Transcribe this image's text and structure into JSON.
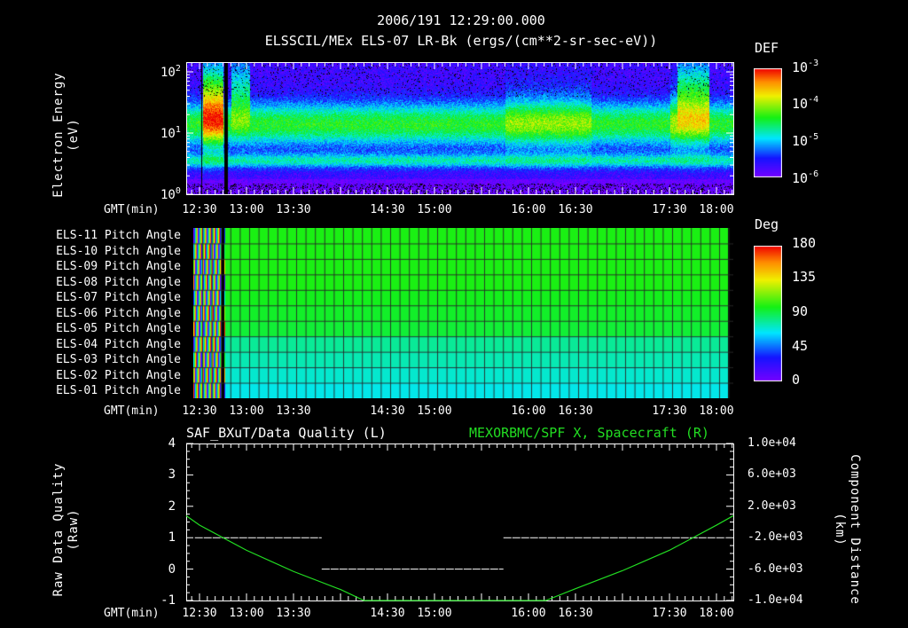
{
  "header": {
    "title_line1": "2006/191 12:29:00.000",
    "title_line2": "ELSSCIL/MEx ELS-07 LR-Bk  (ergs/(cm**2-sr-sec-eV))"
  },
  "time_axis": {
    "label": "GMT(min)",
    "ticks": [
      {
        "label": "12:30",
        "min": 0
      },
      {
        "label": "13:00",
        "min": 30
      },
      {
        "label": "13:30",
        "min": 60
      },
      {
        "label": "14:30",
        "min": 120
      },
      {
        "label": "15:00",
        "min": 150
      },
      {
        "label": "16:00",
        "min": 210
      },
      {
        "label": "16:30",
        "min": 240
      },
      {
        "label": "17:30",
        "min": 300
      },
      {
        "label": "18:00",
        "min": 330
      }
    ],
    "range_min": [
      -8.5,
      340.7
    ]
  },
  "chart_data": [
    {
      "type": "heatmap",
      "title": "ELSSCIL/MEx ELS-07 LR-Bk  (ergs/(cm**2-sr-sec-eV))",
      "ylabel_line1": "Electron Energy",
      "ylabel_line2": "(eV)",
      "yscale": "log",
      "ylim": [
        1,
        145
      ],
      "yticks": [
        {
          "base": "10",
          "exp": "0",
          "value": 1
        },
        {
          "base": "10",
          "exp": "1",
          "value": 10
        },
        {
          "base": "10",
          "exp": "2",
          "value": 100
        }
      ],
      "colorbar": {
        "label": "DEF",
        "scale": "log",
        "range": [
          1e-06,
          0.001
        ],
        "ticks": [
          {
            "base": "10",
            "exp": "-3"
          },
          {
            "base": "10",
            "exp": "-4"
          },
          {
            "base": "10",
            "exp": "-5"
          },
          {
            "base": "10",
            "exp": "-6"
          }
        ]
      },
      "features": "main flux band ~5-30 eV at ~1e-5 to 1e-4; enhancements near 12:35-12:45, 16:00-16:45, 17:30-18:00"
    },
    {
      "type": "heatmap",
      "rows": [
        "ELS-11 Pitch Angle",
        "ELS-10 Pitch Angle",
        "ELS-09 Pitch Angle",
        "ELS-08 Pitch Angle",
        "ELS-07 Pitch Angle",
        "ELS-06 Pitch Angle",
        "ELS-05 Pitch Angle",
        "ELS-04 Pitch Angle",
        "ELS-03 Pitch Angle",
        "ELS-02 Pitch Angle",
        "ELS-01 Pitch Angle"
      ],
      "row_values_deg": [
        100,
        100,
        100,
        100,
        98,
        96,
        94,
        80,
        76,
        72,
        68
      ],
      "colorbar": {
        "label": "Deg",
        "range": [
          0,
          180
        ],
        "ticks": [
          "180",
          "135",
          "90",
          "45",
          "0"
        ]
      }
    },
    {
      "type": "line",
      "title_left": "SAF_BXuT/Data Quality (L)",
      "title_right": "MEXORBMC/SPF X, Spacecraft (R)",
      "ylabel_left_line1": "Raw Data Quality",
      "ylabel_left_line2": "(Raw)",
      "ylabel_right_line1": "Component Distance",
      "ylabel_right_line2": "(km)",
      "ylim_left": [
        -1,
        4
      ],
      "yticks_left": [
        "4",
        "3",
        "2",
        "1",
        "0",
        "-1"
      ],
      "ylim_right": [
        -10000,
        10000
      ],
      "yticks_right": [
        "1.0e+04",
        "6.0e+03",
        "2.0e+03",
        "-2.0e+03",
        "-6.0e+03",
        "-1.0e+04"
      ],
      "series": [
        {
          "name": "Data Quality",
          "axis": "left",
          "color": "#ffffff",
          "segments": [
            {
              "from_min": -3,
              "to_min": 78,
              "value": 1
            },
            {
              "from_min": 78,
              "to_min": 194,
              "value": 0
            },
            {
              "from_min": 194,
              "to_min": 336,
              "value": 1
            }
          ]
        },
        {
          "name": "SPF X",
          "axis": "right",
          "color": "#22dd22",
          "x_min": [
            -8.5,
            0,
            30,
            60,
            90,
            105,
            221,
            240,
            270,
            300,
            330,
            340.7
          ],
          "values": [
            800,
            -400,
            -3600,
            -6300,
            -8600,
            -10000,
            -10000,
            -8500,
            -6200,
            -3600,
            -400,
            800
          ]
        }
      ]
    }
  ]
}
